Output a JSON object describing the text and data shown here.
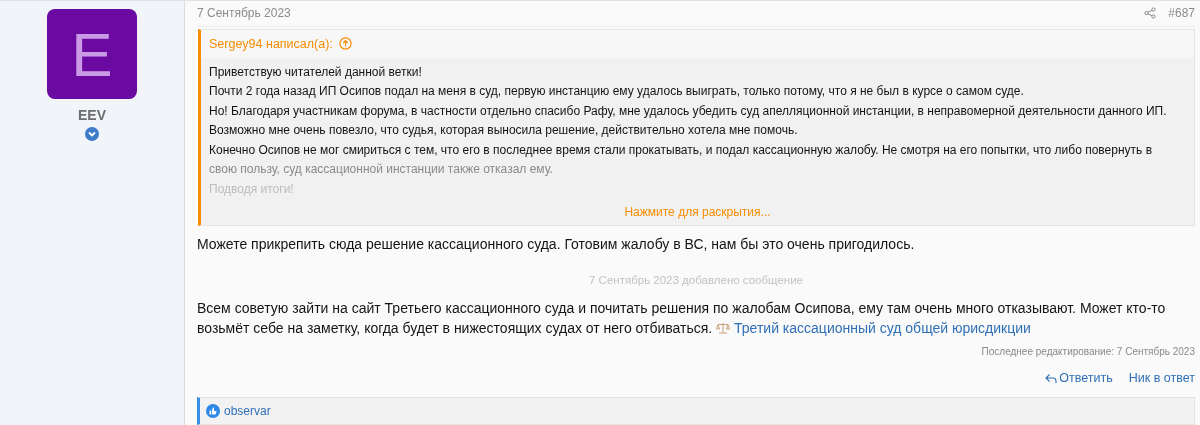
{
  "author": {
    "avatar_letter": "E",
    "name": "EEV"
  },
  "post": {
    "date": "7 Сентябрь 2023",
    "number": "#687",
    "quote": {
      "header": "Sergey94 написал(а):",
      "lines": [
        {
          "text": "Приветствую читателей данной ветки!",
          "kind": "normal"
        },
        {
          "text": "Почти 2 года назад ИП Осипов подал на меня в суд, первую инстанцию ему удалось выиграть, только потому, что я не был в курсе о самом суде.",
          "kind": "normal"
        },
        {
          "text": "Но! Благодаря участникам форума, в частности отдельно спасибо Рафу, мне удалось убедить суд апелляционной инстанции, в неправомерной деятельности данного ИП.",
          "kind": "normal"
        },
        {
          "text": "Возможно мне очень повезло, что судья, которая выносила решение, действительно хотела мне помочь.",
          "kind": "normal"
        },
        {
          "text": "Конечно Осипов не мог смириться с тем, что его в последнее время стали прокатывать, и подал кассационную жалобу. Не смотря на его попытки, что либо повернуть в",
          "kind": "normal"
        },
        {
          "text": "свою пользу, суд кассационной инстанции также отказал ему.",
          "kind": "faded"
        },
        {
          "text": "Подводя итоги!",
          "kind": "faint"
        }
      ],
      "expand": "Нажмите для раскрытия..."
    },
    "reply": "Можете прикрепить сюда решение кассационного суда. Готовим жалобу в ВС, нам бы это очень пригодилось.",
    "merge_note": "7 Сентябрь 2023 добавлено сообщение",
    "message": "Всем советую зайти на сайт Третьего кассационного суда и почитать решения по жалобам Осипова, ему там очень много отказывают. Может кто-то возьмёт себе на заметку, когда будет в нижестоящих судах от него отбиваться.",
    "link": "Третий кассационный суд общей юрисдикции",
    "last_edit": "Последнее редактирование: 7 Сентябрь 2023",
    "actions": [
      {
        "label": "Ответить",
        "kind": "reply"
      },
      {
        "label": "Ник в ответ",
        "kind": "mention"
      }
    ],
    "reactions": {
      "users": "observar"
    }
  }
}
